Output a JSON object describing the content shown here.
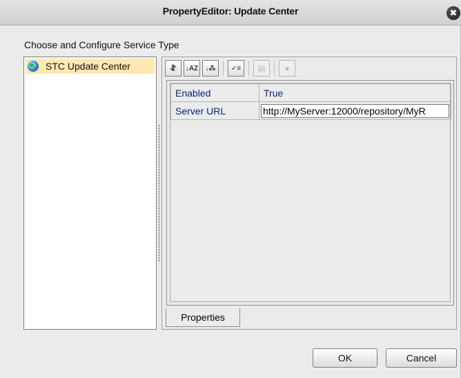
{
  "window": {
    "title": "PropertyEditor: Update Center",
    "close_glyph": "✖"
  },
  "section_label": "Choose and Configure Service Type",
  "service_list": {
    "items": [
      {
        "label": "STC Update Center",
        "icon": "globe-icon",
        "selected": true
      }
    ]
  },
  "toolbar": {
    "buttons": [
      {
        "icon": "collapse-icon",
        "glyph": "⥯",
        "enabled": true
      },
      {
        "icon": "sort-alphabetical-icon",
        "glyph": "↓AZ",
        "enabled": true
      },
      {
        "icon": "sort-category-icon",
        "glyph": "↓⁂",
        "enabled": true
      },
      {
        "icon": "checklist-icon",
        "glyph": "✓≡",
        "enabled": true
      },
      {
        "icon": "list-icon",
        "glyph": "▤",
        "enabled": false
      },
      {
        "icon": "help-icon",
        "glyph": "●",
        "enabled": false
      }
    ]
  },
  "properties": {
    "rows": [
      {
        "name": "Enabled",
        "value": "True"
      },
      {
        "name": "Server URL",
        "value": "http://MyServer:12000/repository/MyR"
      }
    ]
  },
  "tab_label": "Properties",
  "buttons": {
    "ok_label": "OK",
    "cancel_label": "Cancel"
  },
  "colors": {
    "selection": "#ffe9b0",
    "property_text": "#0a1f7a",
    "window_bg": "#ebebeb"
  }
}
